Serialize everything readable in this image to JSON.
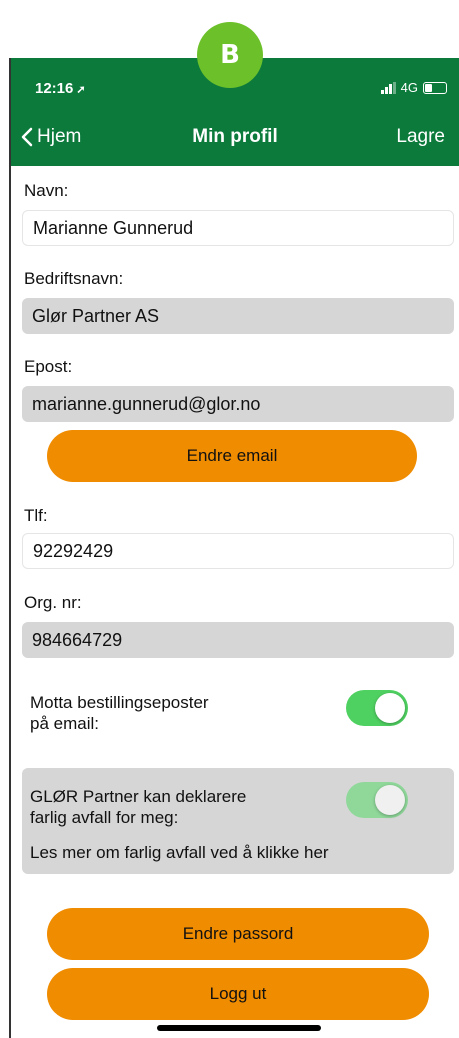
{
  "badge": "B",
  "status": {
    "time": "12:16",
    "network": "4G"
  },
  "nav": {
    "back": "Hjem",
    "title": "Min profil",
    "save": "Lagre"
  },
  "form": {
    "name_label": "Navn:",
    "name_value": "Marianne Gunnerud",
    "company_label": "Bedriftsnavn:",
    "company_value": "Glør Partner AS",
    "email_label": "Epost:",
    "email_value": "marianne.gunnerud@glor.no",
    "change_email": "Endre email",
    "phone_label": "Tlf:",
    "phone_value": "92292429",
    "org_label": "Org. nr:",
    "org_value": "984664729",
    "order_email_label_1": "Motta bestillingseposter",
    "order_email_label_2": "på email:",
    "declare_label_1": "GLØR Partner kan deklarere",
    "declare_label_2": "farlig avfall for meg:",
    "read_more": "Les mer om farlig avfall ved å klikke her",
    "change_password": "Endre passord",
    "logout": "Logg ut"
  },
  "toggles": {
    "order_email": true,
    "declare": true
  },
  "colors": {
    "header": "#0b7a3b",
    "accent": "#f08c00",
    "badge": "#6cc12a",
    "toggle_on": "#4fd161"
  }
}
